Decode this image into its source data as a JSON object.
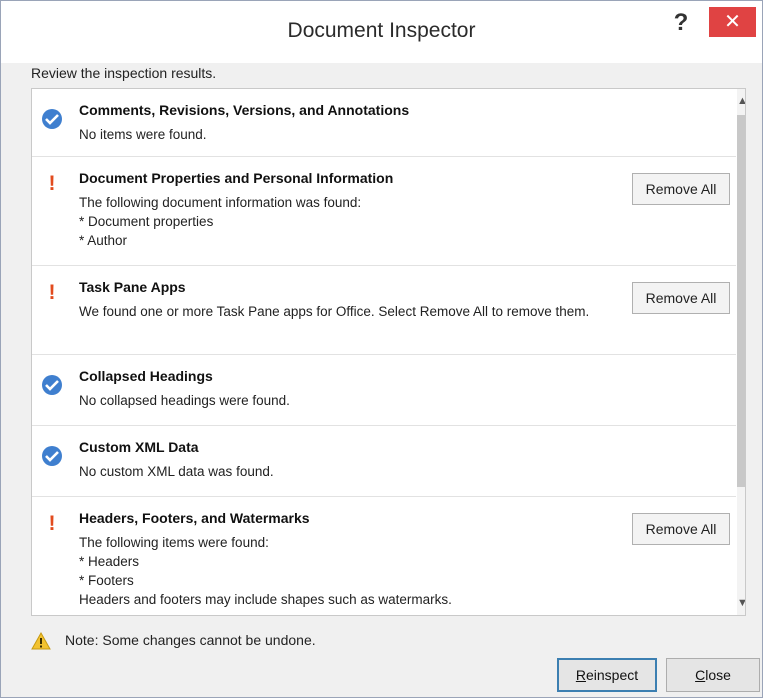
{
  "window": {
    "title": "Document Inspector",
    "help_label": "?",
    "close_label": "✕"
  },
  "subtitle": "Review the inspection results.",
  "results": [
    {
      "status": "ok",
      "heading": "Comments, Revisions, Versions, and Annotations",
      "description": "No items were found.",
      "button": null
    },
    {
      "status": "warning",
      "heading": "Document Properties and Personal Information",
      "description": "The following document information was found:\n* Document properties\n* Author",
      "button": "Remove All"
    },
    {
      "status": "warning",
      "heading": "Task Pane Apps",
      "description": "We found one or more Task Pane apps for Office. Select Remove All to remove them.",
      "button": "Remove All"
    },
    {
      "status": "ok",
      "heading": "Collapsed Headings",
      "description": "No collapsed headings were found.",
      "button": null
    },
    {
      "status": "ok",
      "heading": "Custom XML Data",
      "description": "No custom XML data was found.",
      "button": null
    },
    {
      "status": "warning",
      "heading": "Headers, Footers, and Watermarks",
      "description": "The following items were found:\n* Headers\n* Footers\nHeaders and footers may include shapes such as watermarks.",
      "button": "Remove All"
    }
  ],
  "note": "Note: Some changes cannot be undone.",
  "buttons": {
    "reinspect_underlined": "R",
    "reinspect_rest": "einspect",
    "close_underlined": "C",
    "close_rest": "lose"
  },
  "colors": {
    "ok_icon": "#3f7fcf",
    "warning_icon": "#e24b1e",
    "close_button": "#e04343"
  }
}
